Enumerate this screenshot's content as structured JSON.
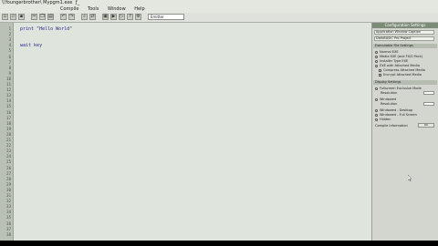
{
  "window": {
    "title": "\\\\Youngerbrother\\ Mypgm1.exe",
    "title_suffix": "ƒ_"
  },
  "menu": {
    "items": [
      "Compile",
      "Tools",
      "Window",
      "Help"
    ]
  },
  "toolbar": {
    "build_select_value": "Emitter"
  },
  "editor": {
    "lines": [
      {
        "n": "1",
        "code": "print \"Hello World\""
      },
      {
        "n": "2",
        "code": ""
      },
      {
        "n": "3",
        "code": "wait key"
      }
    ],
    "line_numbers": [
      "1",
      "2",
      "3",
      "4",
      "5",
      "6",
      "7",
      "8",
      "9",
      "10",
      "11",
      "12",
      "13",
      "14",
      "15",
      "16",
      "17",
      "18",
      "19",
      "20",
      "21",
      "22",
      "23",
      "24",
      "25",
      "26",
      "27",
      "28",
      "29",
      "30",
      "31",
      "32",
      "33",
      "34",
      "35",
      "36",
      "37",
      "38"
    ]
  },
  "panel": {
    "header": "Configuration Settings",
    "field1": "Application Window Caption",
    "field2": "DarkBASIC Pro Project",
    "section_exe": "Executable File Settings",
    "exe_opts": [
      {
        "label": "Normal EXE",
        "kind": "radio"
      },
      {
        "label": "Media EXE (and FX/S Pack)",
        "kind": "radio"
      },
      {
        "label": "Installer Type EXE",
        "kind": "radio"
      },
      {
        "label": "EXE with Attached Media",
        "kind": "radio"
      },
      {
        "label": "Compress Attached Media",
        "kind": "box"
      },
      {
        "label": "Encrypt Attached Media",
        "kind": "box"
      }
    ],
    "section_display": "Display Settings",
    "display_opts": [
      {
        "label": "Fullscreen Exclusive Mode",
        "kind": "radio"
      },
      {
        "label": "Resolution",
        "kind": "field"
      },
      {
        "label": "Windowed",
        "kind": "radio"
      },
      {
        "label": "Resolution",
        "kind": "field"
      },
      {
        "label": "Windowed - Desktop",
        "kind": "radio"
      },
      {
        "label": "Windowed - Full Screen",
        "kind": "radio"
      },
      {
        "label": "Hidden",
        "kind": "radio"
      }
    ],
    "footer_label": "Compile Information",
    "footer_btn": "OK"
  }
}
